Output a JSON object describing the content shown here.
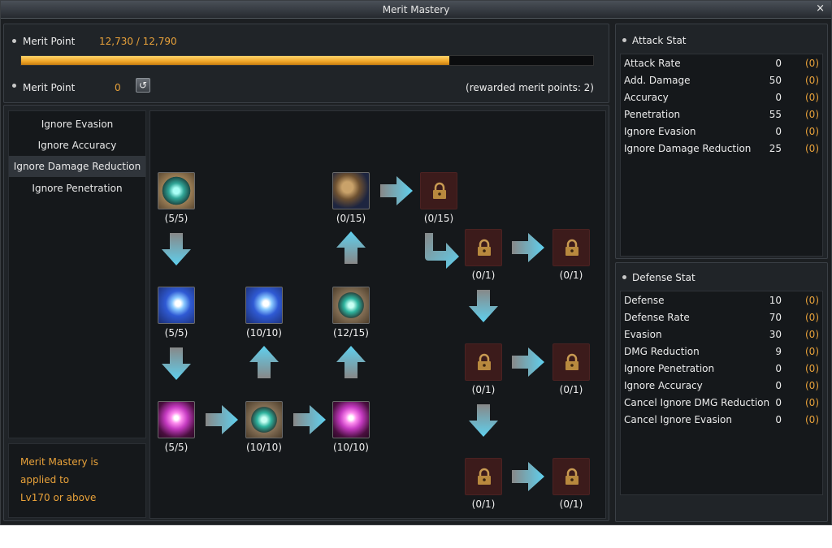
{
  "window": {
    "title": "Merit Mastery",
    "close_label": "×"
  },
  "merit": {
    "label1": "Merit Point",
    "total_value": "12,730 / 12,790",
    "progress": 0.748,
    "label2": "Merit Point",
    "available_value": "0",
    "rewarded_text": "(rewarded merit points: 2)",
    "reset_icon": "reset-icon"
  },
  "categories": [
    {
      "label": "Ignore Evasion"
    },
    {
      "label": "Ignore Accuracy"
    },
    {
      "label": "Ignore Damage Reduction",
      "active": true
    },
    {
      "label": "Ignore Penetration"
    }
  ],
  "note": {
    "line1": "Merit Mastery is",
    "line2": "applied to",
    "line3": "Lv170 or above"
  },
  "tree": {
    "nodes": [
      {
        "id": "n1",
        "count": "(5/5)",
        "icon": "cyan-orb-skill-icon",
        "locked": false
      },
      {
        "id": "n2",
        "count": "(0/15)",
        "icon": "fist-skill-icon",
        "locked": false
      },
      {
        "id": "n3",
        "count": "(0/15)",
        "icon": "lock-icon",
        "locked": true
      },
      {
        "id": "n4",
        "count": "(0/1)",
        "icon": "lock-icon",
        "locked": true
      },
      {
        "id": "n5",
        "count": "(0/1)",
        "icon": "lock-icon",
        "locked": true
      },
      {
        "id": "n6",
        "count": "(5/5)",
        "icon": "blue-fist-skill-icon",
        "locked": false
      },
      {
        "id": "n7",
        "count": "(10/10)",
        "icon": "blue-fist-skill-icon",
        "locked": false
      },
      {
        "id": "n8",
        "count": "(12/15)",
        "icon": "cyan-orb-skill-icon",
        "locked": false
      },
      {
        "id": "n9",
        "count": "(0/1)",
        "icon": "lock-icon",
        "locked": true
      },
      {
        "id": "n10",
        "count": "(0/1)",
        "icon": "lock-icon",
        "locked": true
      },
      {
        "id": "n11",
        "count": "(5/5)",
        "icon": "shadow-skill-icon",
        "locked": false
      },
      {
        "id": "n12",
        "count": "(10/10)",
        "icon": "cyan-orb-skill-icon",
        "locked": false
      },
      {
        "id": "n13",
        "count": "(10/10)",
        "icon": "shadow-skill-icon",
        "locked": false
      },
      {
        "id": "n14",
        "count": "(0/1)",
        "icon": "lock-icon",
        "locked": true
      },
      {
        "id": "n15",
        "count": "(0/1)",
        "icon": "lock-icon",
        "locked": true
      }
    ]
  },
  "attack": {
    "title": "Attack Stat",
    "rows": [
      {
        "name": "Attack Rate",
        "value": "0",
        "bonus": "(0)"
      },
      {
        "name": "Add. Damage",
        "value": "50",
        "bonus": "(0)"
      },
      {
        "name": "Accuracy",
        "value": "0",
        "bonus": "(0)"
      },
      {
        "name": "Penetration",
        "value": "55",
        "bonus": "(0)"
      },
      {
        "name": "Ignore Evasion",
        "value": "0",
        "bonus": "(0)"
      },
      {
        "name": "Ignore Damage Reduction",
        "value": "25",
        "bonus": "(0)"
      }
    ]
  },
  "defense": {
    "title": "Defense Stat",
    "rows": [
      {
        "name": "Defense",
        "value": "10",
        "bonus": "(0)"
      },
      {
        "name": "Defense Rate",
        "value": "70",
        "bonus": "(0)"
      },
      {
        "name": "Evasion",
        "value": "30",
        "bonus": "(0)"
      },
      {
        "name": "DMG Reduction",
        "value": "9",
        "bonus": "(0)"
      },
      {
        "name": "Ignore Penetration",
        "value": "0",
        "bonus": "(0)"
      },
      {
        "name": "Ignore Accuracy",
        "value": "0",
        "bonus": "(0)"
      },
      {
        "name": "Cancel Ignore DMG Reduction",
        "value": "0",
        "bonus": "(0)"
      },
      {
        "name": "Cancel Ignore Evasion",
        "value": "0",
        "bonus": "(0)"
      }
    ]
  },
  "colors": {
    "accent": "#e9a23a",
    "arrow": "#59c6e6",
    "progress": "#f0a628"
  }
}
